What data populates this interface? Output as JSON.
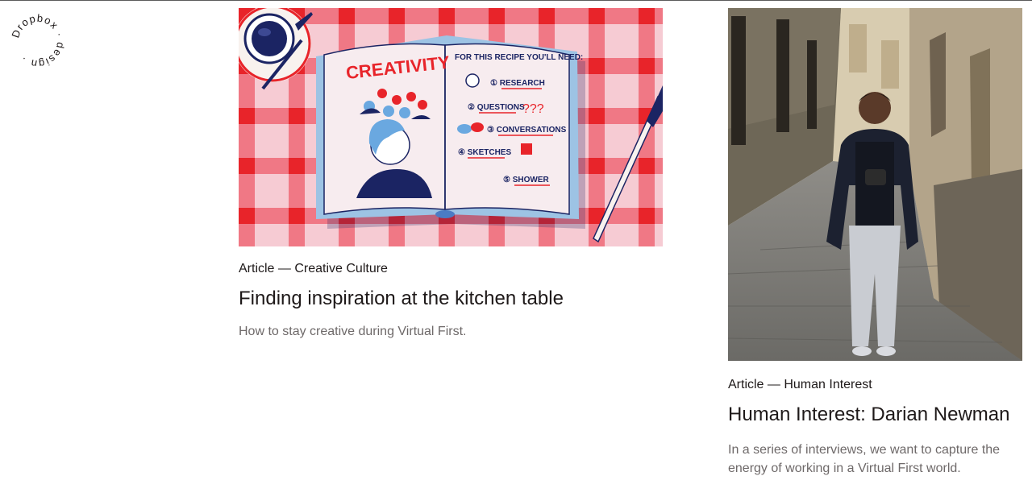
{
  "logo": {
    "text": "Dropbox · design ·",
    "icon": "circular-wordmark"
  },
  "articles": [
    {
      "category": "Article — Creative Culture",
      "title": "Finding inspiration at the kitchen table",
      "description": "How to stay creative during Virtual First.",
      "image": {
        "heading": "CREATIVITY",
        "recipe_title": "FOR THIS RECIPE YOU'LL NEED:",
        "steps": [
          "① RESEARCH",
          "② QUESTIONS",
          "③ CONVERSATIONS",
          "④ SKETCHES",
          "⑤ SHOWER"
        ],
        "question_marks": "???"
      }
    },
    {
      "category": "Article — Human Interest",
      "title": "Human Interest: Darian Newman",
      "description": "In a series of interviews, we want to capture the energy of working in a Virtual First world."
    }
  ],
  "colors": {
    "text": "#1e1919",
    "muted": "#6e6969",
    "red": "#e8242a",
    "navy": "#1b2463"
  }
}
